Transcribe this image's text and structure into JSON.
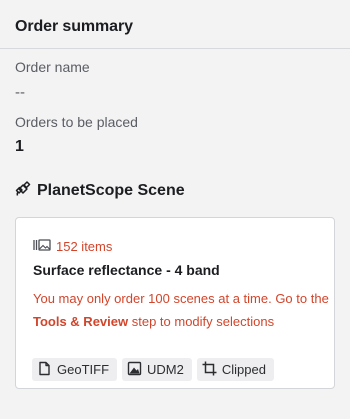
{
  "summary": {
    "title": "Order summary",
    "order_name_label": "Order name",
    "order_name_value": "--",
    "orders_label": "Orders to be placed",
    "orders_value": "1"
  },
  "product": {
    "icon": "satellite-icon",
    "name": "PlanetScope Scene"
  },
  "card": {
    "items_icon": "images-icon",
    "items_count": "152 items",
    "bundle_name": "Surface reflectance - 4 band",
    "warning_prefix": "You may only order 100 scenes at a time. Go to the ",
    "warning_link": "Tools & Review",
    "warning_suffix": " step to modify selections",
    "chips": [
      {
        "icon": "file-icon",
        "label": "GeoTIFF"
      },
      {
        "icon": "image-icon",
        "label": "UDM2"
      },
      {
        "icon": "crop-icon",
        "label": "Clipped"
      }
    ]
  },
  "colors": {
    "warning": "#d2452b",
    "background": "#f3f3f4",
    "card": "#ffffff"
  }
}
